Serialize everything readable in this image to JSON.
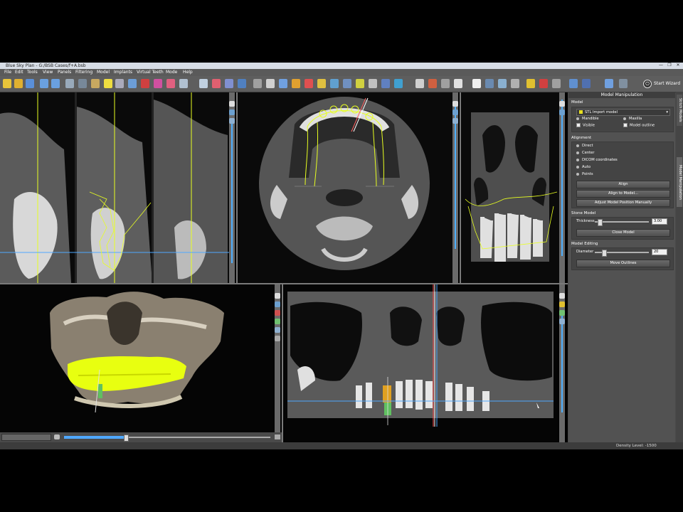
{
  "window": {
    "title": "Blue Sky Plan - G:/BSB Cases/f+A.bsb",
    "minimize": "—",
    "maximize": "❐",
    "close": "✕"
  },
  "menu": [
    "File",
    "Edit",
    "Tools",
    "View",
    "Panels",
    "Filtering",
    "Model",
    "Implants",
    "Virtual Teeth",
    "Mode",
    "Help"
  ],
  "toolbar": {
    "start_wizard": "Start Wizard"
  },
  "panel": {
    "title": "Model Manipulation",
    "model": {
      "label": "Model",
      "selected": "STL Import model",
      "mandible": "Mandible",
      "maxilla": "Maxilla",
      "visible": "Visible",
      "model_outline": "Model outline"
    },
    "alignment": {
      "label": "Alignment",
      "options": [
        "Direct",
        "Center",
        "DICOM coordinates",
        "Auto",
        "Points"
      ],
      "align": "Align",
      "align_to_model": "Align to Model...",
      "adjust_manually": "Adjust Model Position Manually"
    },
    "stone_model": {
      "label": "Stone Model",
      "thickness_label": "Thickness",
      "thickness_value": "3.00",
      "close_model": "Close Model"
    },
    "model_editing": {
      "label": "Model Editing",
      "diameter_label": "Diameter",
      "diameter_value": "20",
      "move_outlines": "Move Outlines"
    }
  },
  "side_tabs": [
    "Stitch Models",
    "Model Manipulation"
  ],
  "status": {
    "density": "Density Level: -1500"
  },
  "colors": {
    "accent_yellow": "#e8ff20",
    "scan_line": "#4fa8ff",
    "panel_bg": "#525252"
  }
}
